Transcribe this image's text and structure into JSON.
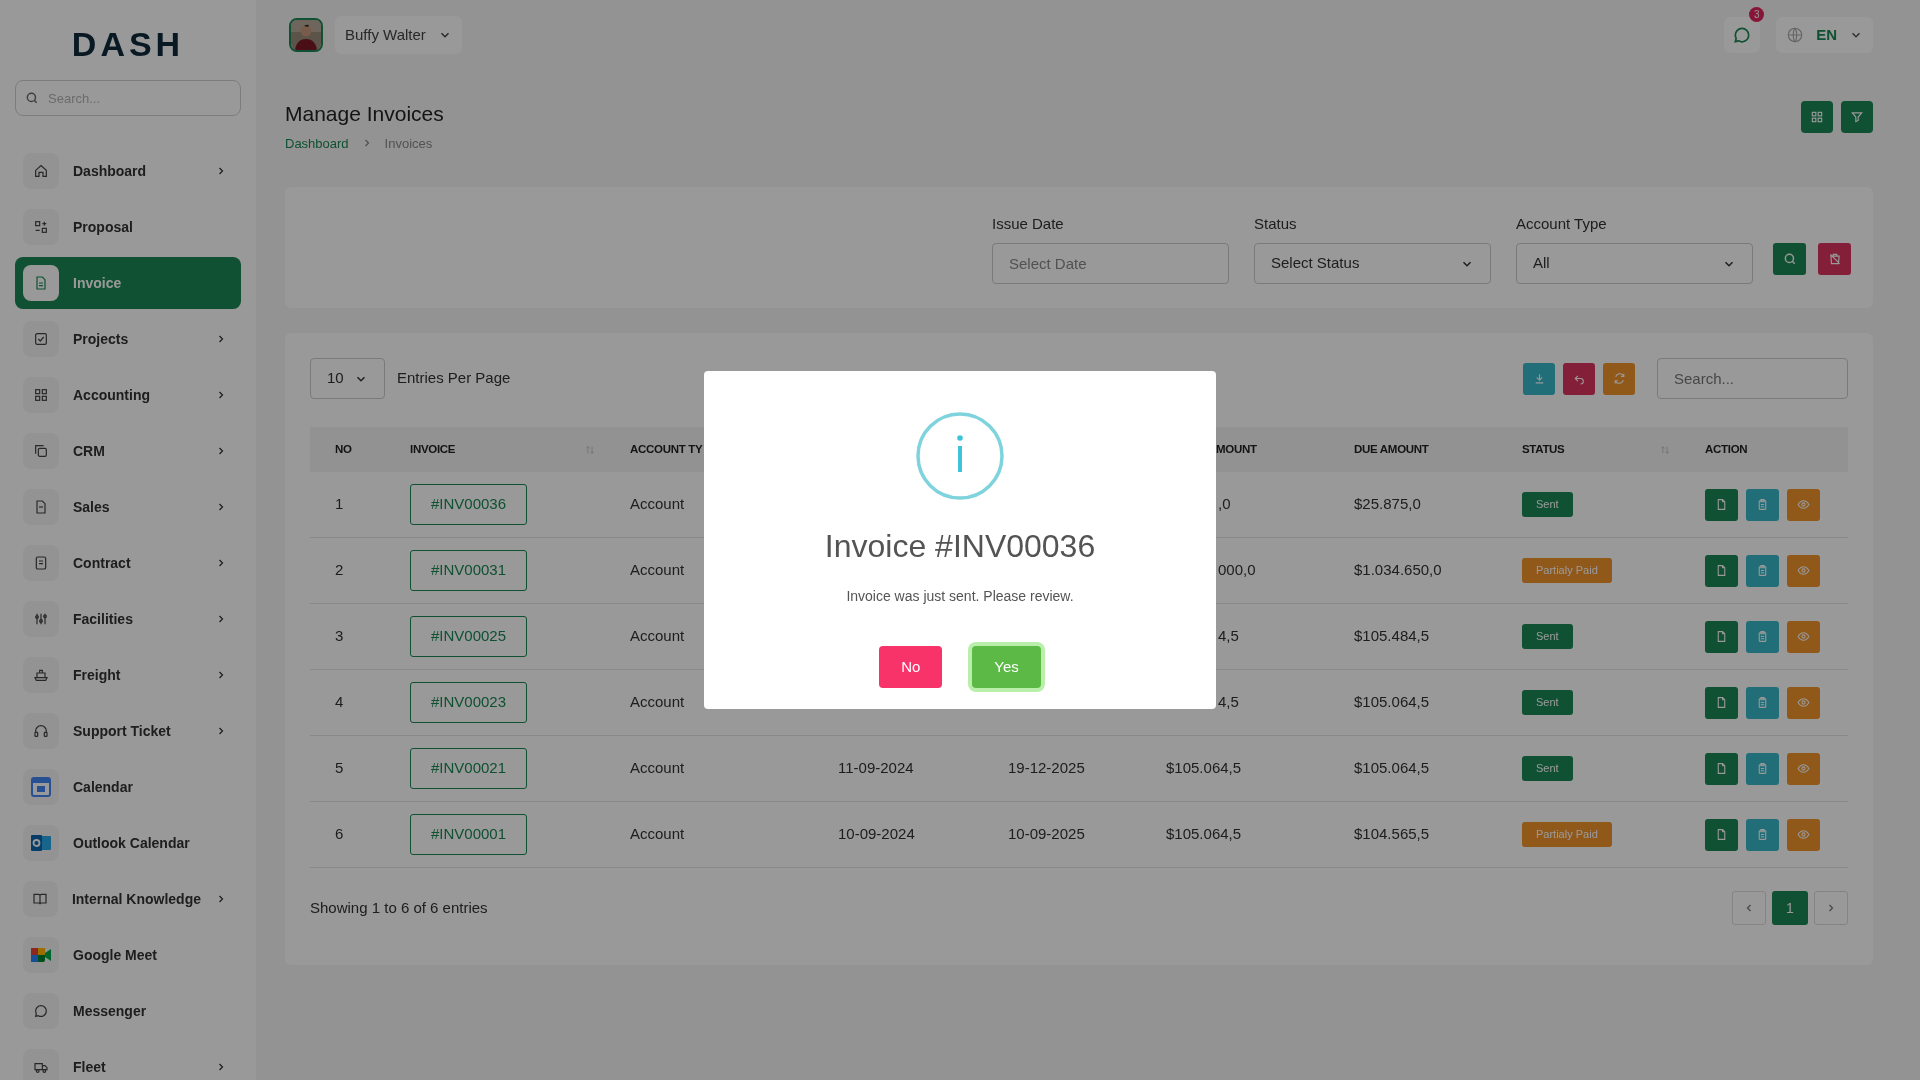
{
  "logo": {
    "text": "DASH"
  },
  "sidebar": {
    "search_placeholder": "Search...",
    "items": [
      {
        "label": "Dashboard",
        "selected": false,
        "has_children": true
      },
      {
        "label": "Proposal",
        "selected": false,
        "has_children": false
      },
      {
        "label": "Invoice",
        "selected": true,
        "has_children": false
      },
      {
        "label": "Projects",
        "selected": false,
        "has_children": true
      },
      {
        "label": "Accounting",
        "selected": false,
        "has_children": true
      },
      {
        "label": "CRM",
        "selected": false,
        "has_children": true
      },
      {
        "label": "Sales",
        "selected": false,
        "has_children": true
      },
      {
        "label": "Contract",
        "selected": false,
        "has_children": true
      },
      {
        "label": "Facilities",
        "selected": false,
        "has_children": true
      },
      {
        "label": "Freight",
        "selected": false,
        "has_children": true
      },
      {
        "label": "Support Ticket",
        "selected": false,
        "has_children": true
      },
      {
        "label": "Calendar",
        "selected": false,
        "has_children": false
      },
      {
        "label": "Outlook Calendar",
        "selected": false,
        "has_children": false
      },
      {
        "label": "Internal Knowledge",
        "selected": false,
        "has_children": true
      },
      {
        "label": "Google Meet",
        "selected": false,
        "has_children": false
      },
      {
        "label": "Messenger",
        "selected": false,
        "has_children": false
      },
      {
        "label": "Fleet",
        "selected": false,
        "has_children": true
      }
    ]
  },
  "user": {
    "name": "Buffy Walter"
  },
  "notifications": {
    "count": "3"
  },
  "language": "EN",
  "page": {
    "title": "Manage Invoices",
    "breadcrumb": [
      "Dashboard",
      "Invoices"
    ]
  },
  "filters": [
    {
      "label": "Issue Date",
      "placeholder": "Select Date",
      "kind": "date"
    },
    {
      "label": "Status",
      "value": "Select Status",
      "kind": "select"
    },
    {
      "label": "Account Type",
      "value": "All",
      "kind": "select"
    }
  ],
  "entries": {
    "value": "10",
    "label": "Entries Per Page"
  },
  "table_search": {
    "placeholder": "Search..."
  },
  "table": {
    "columns": [
      {
        "label": "NO",
        "sortable": false
      },
      {
        "label": "INVOICE",
        "sortable": true
      },
      {
        "label": "ACCOUNT TY"
      },
      {
        "label": "MOUNT",
        "sortable": false
      },
      {
        "label": "DUE AMOUNT",
        "sortable": false
      },
      {
        "label": "STATUS",
        "sortable": true
      },
      {
        "label": "ACTION",
        "sortable": false
      }
    ],
    "rows": [
      {
        "no": "1",
        "invoice": "#INV00036",
        "account_type": "Account",
        "amount": ",0",
        "due_amount": "$25.875,0",
        "status": {
          "text": "Sent",
          "kind": "sent"
        }
      },
      {
        "no": "2",
        "invoice": "#INV00031",
        "account_type": "Account",
        "amount": "000,0",
        "due_amount": "$1.034.650,0",
        "status": {
          "text": "Partialy Paid",
          "kind": "partial"
        }
      },
      {
        "no": "3",
        "invoice": "#INV00025",
        "account_type": "Account",
        "amount": "4,5",
        "due_amount": "$105.484,5",
        "status": {
          "text": "Sent",
          "kind": "sent"
        }
      },
      {
        "no": "4",
        "invoice": "#INV00023",
        "account_type": "Account",
        "amount": "4,5",
        "due_amount": "$105.064,5",
        "status": {
          "text": "Sent",
          "kind": "sent"
        }
      },
      {
        "no": "5",
        "invoice": "#INV00021",
        "account_type": "Account",
        "issue_date": "11-09-2024",
        "due_date": "19-12-2025",
        "amount": "$105.064,5",
        "due_amount": "$105.064,5",
        "status": {
          "text": "Sent",
          "kind": "sent"
        }
      },
      {
        "no": "6",
        "invoice": "#INV00001",
        "account_type": "Account",
        "issue_date": "10-09-2024",
        "due_date": "10-09-2025",
        "amount": "$105.064,5",
        "due_amount": "$104.565,5",
        "status": {
          "text": "Partialy Paid",
          "kind": "partial"
        }
      }
    ]
  },
  "footer": "Showing 1 to 6 of 6 entries",
  "pagination": {
    "pages": [
      {
        "label": "1",
        "selected": true
      }
    ]
  },
  "dialog": {
    "title": "Invoice #INV00036",
    "message": "Invoice was just sent. Please review.",
    "buttons": [
      {
        "label": "No",
        "kind": "cancel",
        "focused": false
      },
      {
        "label": "Yes",
        "kind": "confirm",
        "focused": true
      }
    ]
  }
}
